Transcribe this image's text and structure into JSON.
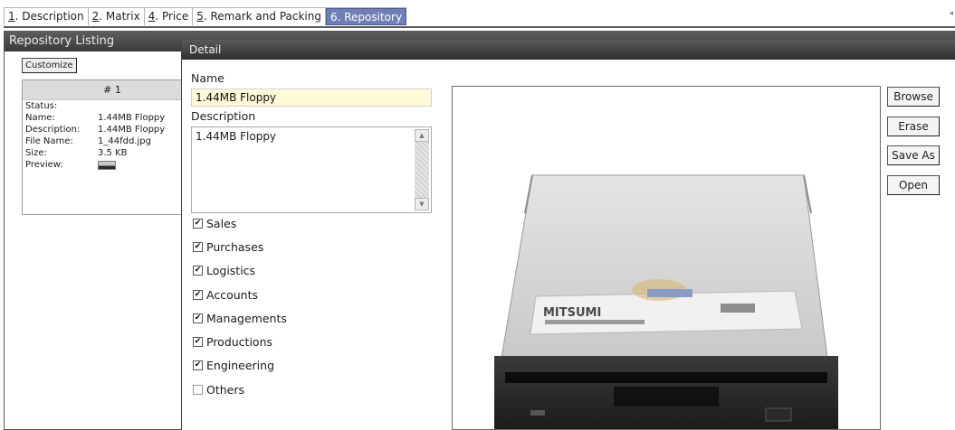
{
  "tabs": [
    {
      "key": "1",
      "rest": ". Description",
      "active": false
    },
    {
      "key": "2",
      "rest": ". Matrix",
      "active": false
    },
    {
      "key": "4",
      "rest": ". Price",
      "active": false
    },
    {
      "key": "5",
      "rest": ". Remark and Packing",
      "active": false
    },
    {
      "key": "",
      "rest": "6. Repository",
      "active": true
    }
  ],
  "listing": {
    "title": "Repository Listing",
    "customize_label": "Customize",
    "record": {
      "header": "# 1",
      "rows": [
        {
          "label": "Status:",
          "value": ""
        },
        {
          "label": "Name:",
          "value": "1.44MB Floppy"
        },
        {
          "label": "Description:",
          "value": "1.44MB Floppy"
        },
        {
          "label": "File Name:",
          "value": "1_44fdd.jpg"
        },
        {
          "label": "Size:",
          "value": "3.5 KB"
        },
        {
          "label": "Preview:",
          "value": ""
        }
      ]
    }
  },
  "detail": {
    "title": "Detail",
    "name_label": "Name",
    "name_value": "1.44MB Floppy",
    "description_label": "Description",
    "description_value": "1.44MB Floppy",
    "checkboxes": [
      {
        "label": "Sales",
        "checked": true
      },
      {
        "label": "Purchases",
        "checked": true
      },
      {
        "label": "Logistics",
        "checked": true
      },
      {
        "label": "Accounts",
        "checked": true
      },
      {
        "label": "Managements",
        "checked": true
      },
      {
        "label": "Productions",
        "checked": true
      },
      {
        "label": "Engineering",
        "checked": true
      },
      {
        "label": "Others",
        "checked": false
      }
    ],
    "preview_brand": "MITSUMI",
    "buttons": {
      "browse": "Browse",
      "erase": "Erase",
      "save_as": "Save As",
      "open": "Open"
    }
  }
}
